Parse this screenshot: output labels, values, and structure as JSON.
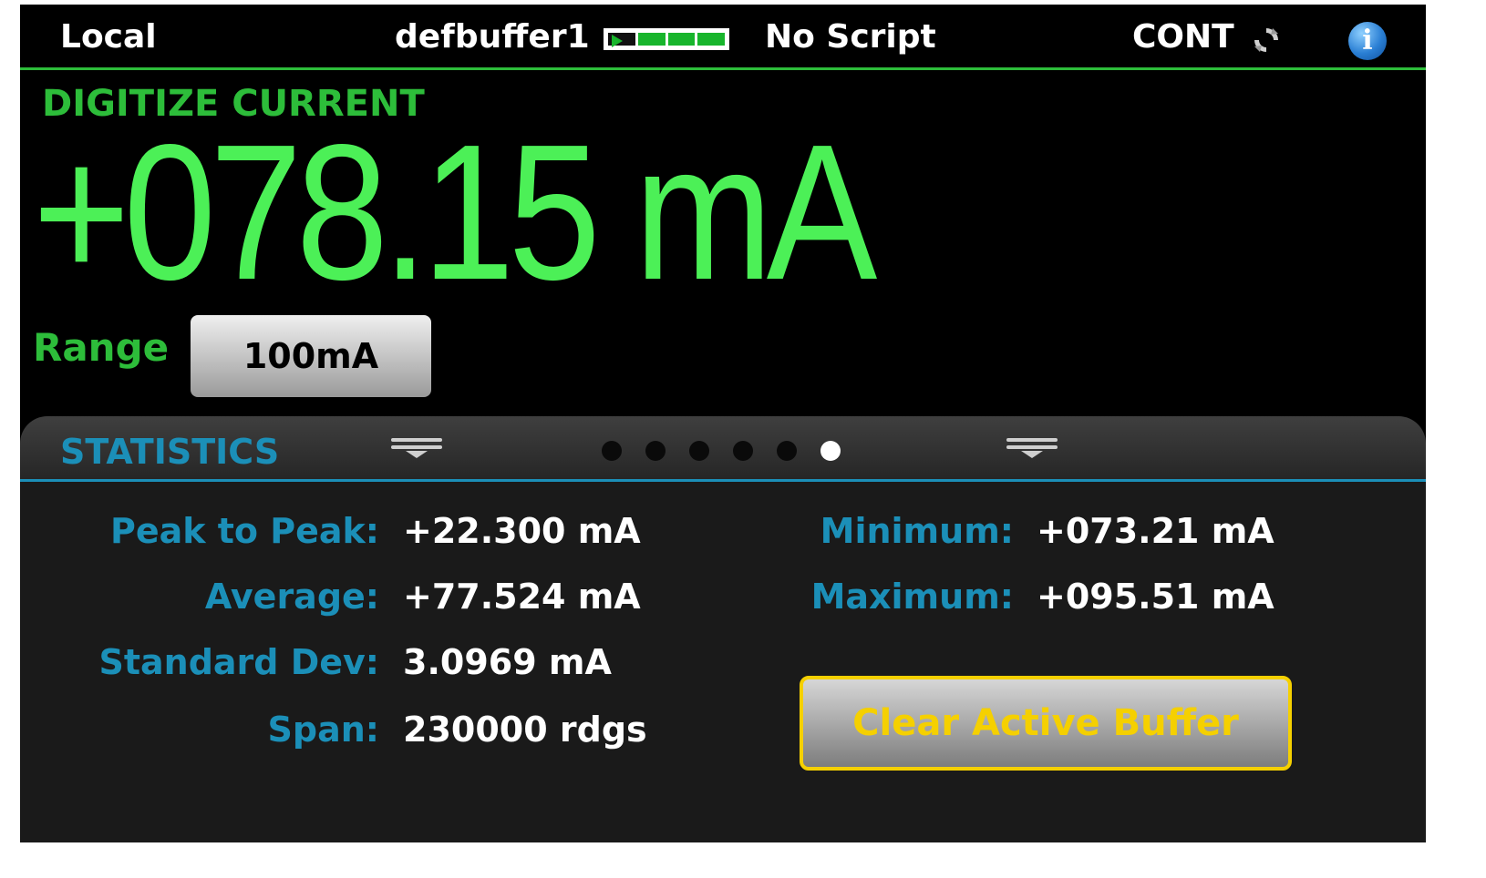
{
  "status_bar": {
    "mode": "Local",
    "buffer_name": "defbuffer1",
    "buffer_fill_icon": "buffer-fill-meter",
    "script": "No Script",
    "trigger_mode": "CONT",
    "trigger_icon": "refresh-icon",
    "info_icon": "info-icon"
  },
  "measurement": {
    "function": "DIGITIZE CURRENT",
    "reading": "+078.15 mA",
    "range_label": "Range",
    "range_value": "100mA"
  },
  "swipe": {
    "title": "STATISTICS",
    "page_count": 6,
    "active_page": 6
  },
  "statistics": {
    "peak_to_peak_label": "Peak to Peak:",
    "peak_to_peak_value": "+22.300 mA",
    "average_label": "Average:",
    "average_value": "+77.524 mA",
    "std_dev_label": "Standard Dev:",
    "std_dev_value": "3.0969 mA",
    "span_label": "Span:",
    "span_value": "230000 rdgs",
    "minimum_label": "Minimum:",
    "minimum_value": "+073.21 mA",
    "maximum_label": "Maximum:",
    "maximum_value": "+095.51 mA",
    "clear_button_label": "Clear Active Buffer"
  },
  "colors": {
    "reading_green": "#4cf057",
    "label_green": "#2dbd3a",
    "stat_blue": "#1b8fb8",
    "button_yellow": "#f5d000"
  }
}
